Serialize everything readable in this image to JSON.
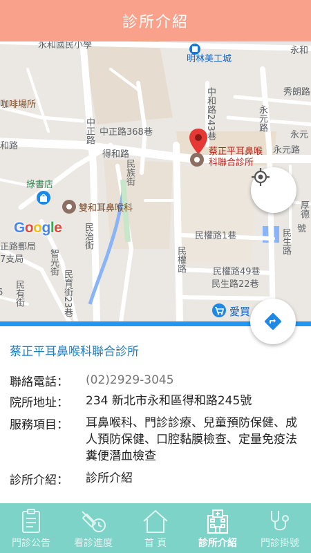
{
  "header": {
    "title": "診所介紹"
  },
  "map": {
    "labels": {
      "school": "永和國民小學",
      "minglin": "明林美工城",
      "yonghe_edge": "永和",
      "xiulang": "秀朗路",
      "cafe": "咖啡場所",
      "road243": "中和路243巷",
      "zhongzheng368": "中正路368巷",
      "zhongzheng": "中正路",
      "yongyuan": "永元路",
      "yongyuan_edge": "永元",
      "yongyuan_road": "永元路",
      "deherd_left": "和路",
      "dehe": "得和路",
      "clinic_marker": "蔡正平耳鼻喉科聯合診所",
      "bookstore": "綠書店",
      "minzu": "民族街",
      "shuanghe": "雙和耳鼻喉科",
      "hou": "厚德",
      "minzhi": "民治街",
      "post": "正路郵局",
      "post_branch": "7支局",
      "zhiguang": "智光街",
      "minquan1": "民權路1巷",
      "minquan": "民權路",
      "minsheng": "民生路",
      "minyou": "民有街",
      "minyu23": "民育街23巷",
      "minquan49": "民權路49巷",
      "minsheng22": "民生路22巷",
      "aimai": "愛買",
      "edge_6": "6",
      "hao": "號",
      "google": "Google"
    }
  },
  "clinic": {
    "name": "蔡正平耳鼻喉科聯合診所",
    "phone_label": "聯絡電話：",
    "phone": "(02)2929-3045",
    "address_label": "院所地址：",
    "address": "234 新北市永和區得和路245號",
    "services_label": "服務項目：",
    "services": "耳鼻喉科、門診診療、兒童預防保健、成人預防保健、口腔黏膜檢查、定量免疫法糞便潛血檢查",
    "intro_label": "診所介紹：",
    "intro": "診所介紹"
  },
  "bottom_nav": [
    {
      "label": "門診公告",
      "icon": "clipboard-icon"
    },
    {
      "label": "看診進度",
      "icon": "syringe-clock-icon"
    },
    {
      "label": "首 頁",
      "icon": "home-icon"
    },
    {
      "label": "診所介紹",
      "icon": "hospital-icon",
      "active": true
    },
    {
      "label": "門診掛號",
      "icon": "stethoscope-icon"
    }
  ],
  "colors": {
    "header": "#f9a18b",
    "nav": "#7dd3c7",
    "accent": "#1f7fc1",
    "pin": "#e53935"
  }
}
